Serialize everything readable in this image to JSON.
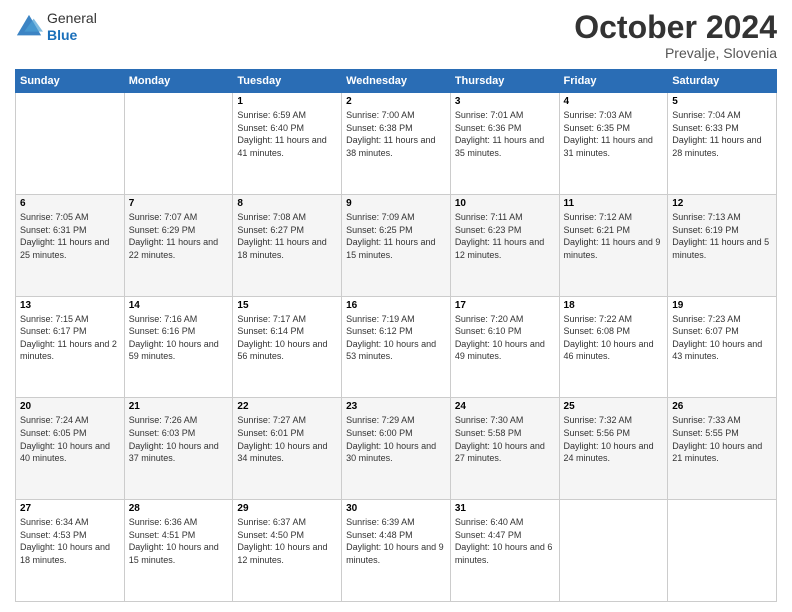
{
  "header": {
    "logo_line1": "General",
    "logo_line2": "Blue",
    "month": "October 2024",
    "location": "Prevalje, Slovenia"
  },
  "weekdays": [
    "Sunday",
    "Monday",
    "Tuesday",
    "Wednesday",
    "Thursday",
    "Friday",
    "Saturday"
  ],
  "weeks": [
    [
      {
        "day": "",
        "sunrise": "",
        "sunset": "",
        "daylight": ""
      },
      {
        "day": "",
        "sunrise": "",
        "sunset": "",
        "daylight": ""
      },
      {
        "day": "1",
        "sunrise": "Sunrise: 6:59 AM",
        "sunset": "Sunset: 6:40 PM",
        "daylight": "Daylight: 11 hours and 41 minutes."
      },
      {
        "day": "2",
        "sunrise": "Sunrise: 7:00 AM",
        "sunset": "Sunset: 6:38 PM",
        "daylight": "Daylight: 11 hours and 38 minutes."
      },
      {
        "day": "3",
        "sunrise": "Sunrise: 7:01 AM",
        "sunset": "Sunset: 6:36 PM",
        "daylight": "Daylight: 11 hours and 35 minutes."
      },
      {
        "day": "4",
        "sunrise": "Sunrise: 7:03 AM",
        "sunset": "Sunset: 6:35 PM",
        "daylight": "Daylight: 11 hours and 31 minutes."
      },
      {
        "day": "5",
        "sunrise": "Sunrise: 7:04 AM",
        "sunset": "Sunset: 6:33 PM",
        "daylight": "Daylight: 11 hours and 28 minutes."
      }
    ],
    [
      {
        "day": "6",
        "sunrise": "Sunrise: 7:05 AM",
        "sunset": "Sunset: 6:31 PM",
        "daylight": "Daylight: 11 hours and 25 minutes."
      },
      {
        "day": "7",
        "sunrise": "Sunrise: 7:07 AM",
        "sunset": "Sunset: 6:29 PM",
        "daylight": "Daylight: 11 hours and 22 minutes."
      },
      {
        "day": "8",
        "sunrise": "Sunrise: 7:08 AM",
        "sunset": "Sunset: 6:27 PM",
        "daylight": "Daylight: 11 hours and 18 minutes."
      },
      {
        "day": "9",
        "sunrise": "Sunrise: 7:09 AM",
        "sunset": "Sunset: 6:25 PM",
        "daylight": "Daylight: 11 hours and 15 minutes."
      },
      {
        "day": "10",
        "sunrise": "Sunrise: 7:11 AM",
        "sunset": "Sunset: 6:23 PM",
        "daylight": "Daylight: 11 hours and 12 minutes."
      },
      {
        "day": "11",
        "sunrise": "Sunrise: 7:12 AM",
        "sunset": "Sunset: 6:21 PM",
        "daylight": "Daylight: 11 hours and 9 minutes."
      },
      {
        "day": "12",
        "sunrise": "Sunrise: 7:13 AM",
        "sunset": "Sunset: 6:19 PM",
        "daylight": "Daylight: 11 hours and 5 minutes."
      }
    ],
    [
      {
        "day": "13",
        "sunrise": "Sunrise: 7:15 AM",
        "sunset": "Sunset: 6:17 PM",
        "daylight": "Daylight: 11 hours and 2 minutes."
      },
      {
        "day": "14",
        "sunrise": "Sunrise: 7:16 AM",
        "sunset": "Sunset: 6:16 PM",
        "daylight": "Daylight: 10 hours and 59 minutes."
      },
      {
        "day": "15",
        "sunrise": "Sunrise: 7:17 AM",
        "sunset": "Sunset: 6:14 PM",
        "daylight": "Daylight: 10 hours and 56 minutes."
      },
      {
        "day": "16",
        "sunrise": "Sunrise: 7:19 AM",
        "sunset": "Sunset: 6:12 PM",
        "daylight": "Daylight: 10 hours and 53 minutes."
      },
      {
        "day": "17",
        "sunrise": "Sunrise: 7:20 AM",
        "sunset": "Sunset: 6:10 PM",
        "daylight": "Daylight: 10 hours and 49 minutes."
      },
      {
        "day": "18",
        "sunrise": "Sunrise: 7:22 AM",
        "sunset": "Sunset: 6:08 PM",
        "daylight": "Daylight: 10 hours and 46 minutes."
      },
      {
        "day": "19",
        "sunrise": "Sunrise: 7:23 AM",
        "sunset": "Sunset: 6:07 PM",
        "daylight": "Daylight: 10 hours and 43 minutes."
      }
    ],
    [
      {
        "day": "20",
        "sunrise": "Sunrise: 7:24 AM",
        "sunset": "Sunset: 6:05 PM",
        "daylight": "Daylight: 10 hours and 40 minutes."
      },
      {
        "day": "21",
        "sunrise": "Sunrise: 7:26 AM",
        "sunset": "Sunset: 6:03 PM",
        "daylight": "Daylight: 10 hours and 37 minutes."
      },
      {
        "day": "22",
        "sunrise": "Sunrise: 7:27 AM",
        "sunset": "Sunset: 6:01 PM",
        "daylight": "Daylight: 10 hours and 34 minutes."
      },
      {
        "day": "23",
        "sunrise": "Sunrise: 7:29 AM",
        "sunset": "Sunset: 6:00 PM",
        "daylight": "Daylight: 10 hours and 30 minutes."
      },
      {
        "day": "24",
        "sunrise": "Sunrise: 7:30 AM",
        "sunset": "Sunset: 5:58 PM",
        "daylight": "Daylight: 10 hours and 27 minutes."
      },
      {
        "day": "25",
        "sunrise": "Sunrise: 7:32 AM",
        "sunset": "Sunset: 5:56 PM",
        "daylight": "Daylight: 10 hours and 24 minutes."
      },
      {
        "day": "26",
        "sunrise": "Sunrise: 7:33 AM",
        "sunset": "Sunset: 5:55 PM",
        "daylight": "Daylight: 10 hours and 21 minutes."
      }
    ],
    [
      {
        "day": "27",
        "sunrise": "Sunrise: 6:34 AM",
        "sunset": "Sunset: 4:53 PM",
        "daylight": "Daylight: 10 hours and 18 minutes."
      },
      {
        "day": "28",
        "sunrise": "Sunrise: 6:36 AM",
        "sunset": "Sunset: 4:51 PM",
        "daylight": "Daylight: 10 hours and 15 minutes."
      },
      {
        "day": "29",
        "sunrise": "Sunrise: 6:37 AM",
        "sunset": "Sunset: 4:50 PM",
        "daylight": "Daylight: 10 hours and 12 minutes."
      },
      {
        "day": "30",
        "sunrise": "Sunrise: 6:39 AM",
        "sunset": "Sunset: 4:48 PM",
        "daylight": "Daylight: 10 hours and 9 minutes."
      },
      {
        "day": "31",
        "sunrise": "Sunrise: 6:40 AM",
        "sunset": "Sunset: 4:47 PM",
        "daylight": "Daylight: 10 hours and 6 minutes."
      },
      {
        "day": "",
        "sunrise": "",
        "sunset": "",
        "daylight": ""
      },
      {
        "day": "",
        "sunrise": "",
        "sunset": "",
        "daylight": ""
      }
    ]
  ]
}
